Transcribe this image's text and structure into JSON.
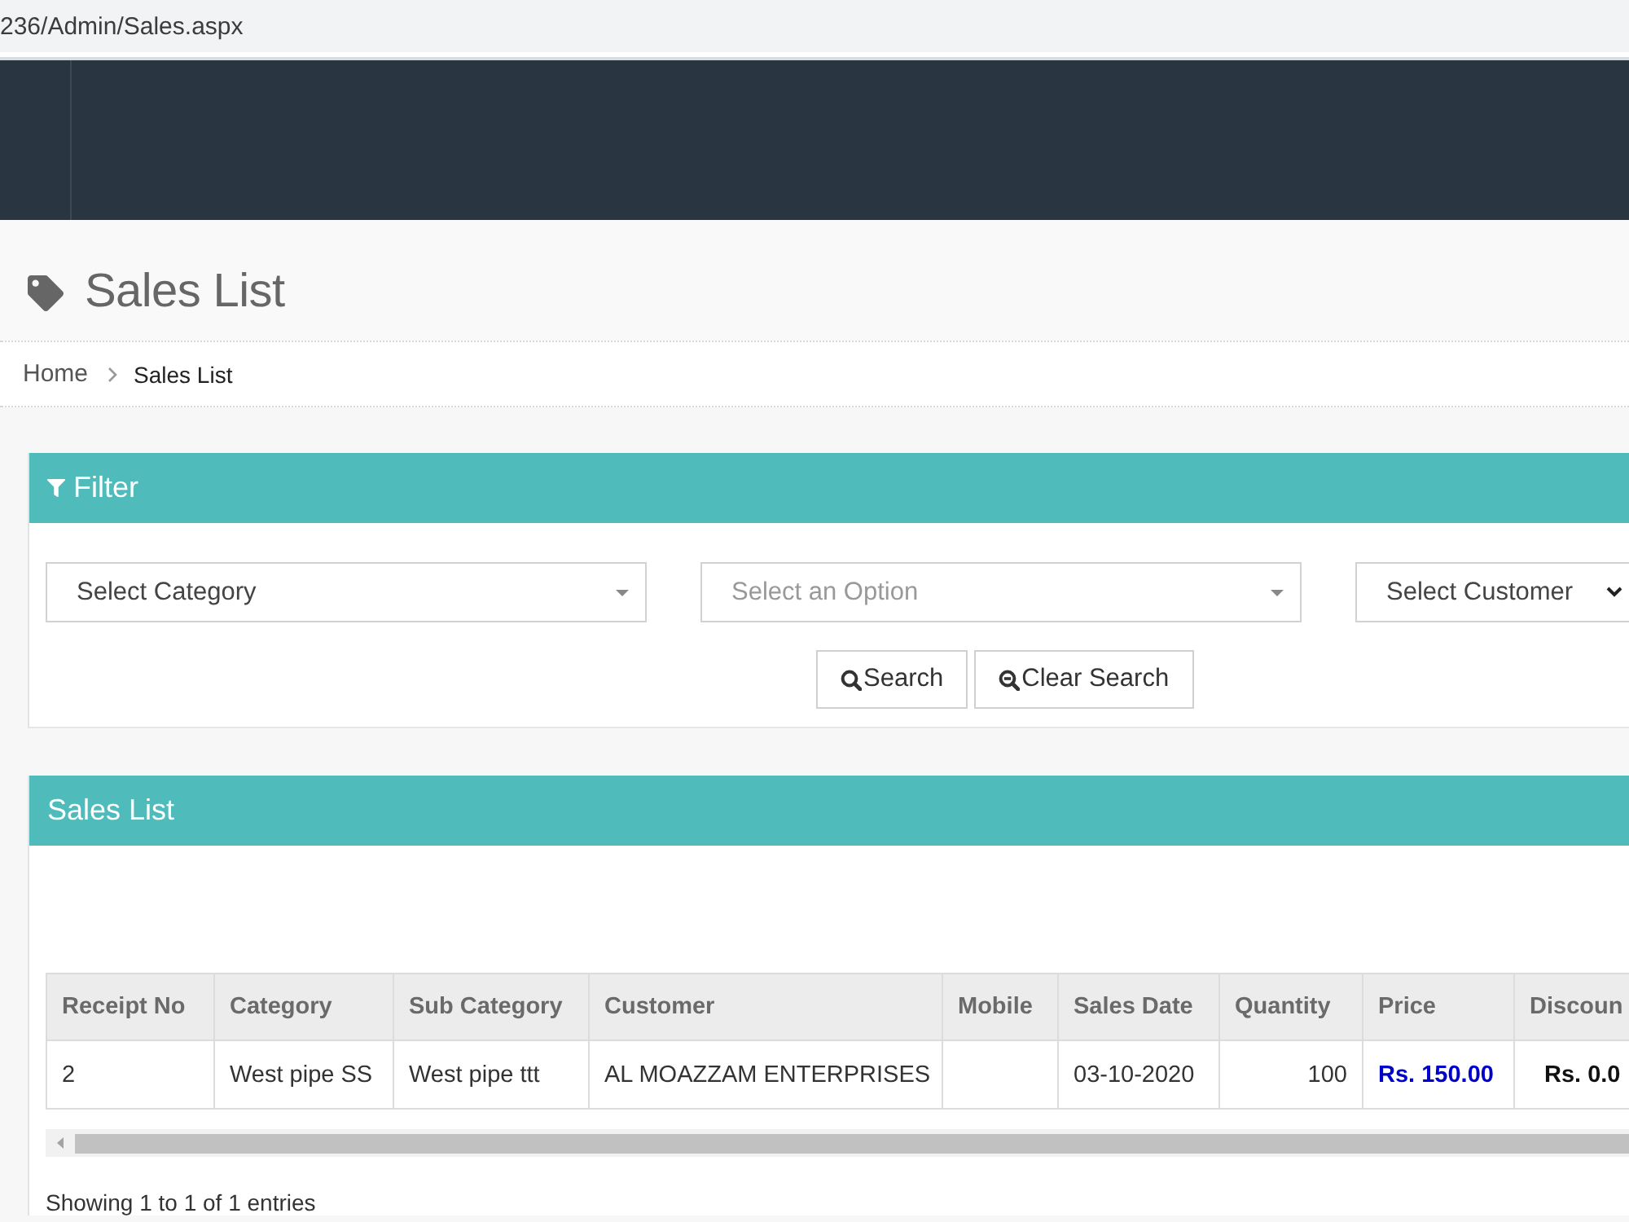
{
  "browser": {
    "url": "236/Admin/Sales.aspx"
  },
  "page_header": {
    "title": "Sales List"
  },
  "breadcrumb": [
    {
      "label": "Home"
    },
    {
      "label": "Sales List"
    }
  ],
  "filter_panel": {
    "title": "Filter",
    "selects": [
      {
        "kind": "select2",
        "value": "Select Category"
      },
      {
        "kind": "select2",
        "placeholder": "Select an Option"
      },
      {
        "kind": "native",
        "value": "Select Customer"
      }
    ],
    "buttons": [
      {
        "kind": "search",
        "label": "Search"
      },
      {
        "kind": "clear",
        "label": "Clear Search"
      }
    ]
  },
  "sales_panel": {
    "title": "Sales List",
    "table": {
      "columns": [
        {
          "label": "Receipt No",
          "kind": "text"
        },
        {
          "label": "Category",
          "kind": "text"
        },
        {
          "label": "Sub Category",
          "kind": "text"
        },
        {
          "label": "Customer",
          "kind": "text"
        },
        {
          "label": "Mobile",
          "kind": "text"
        },
        {
          "label": "Sales Date",
          "kind": "text"
        },
        {
          "label": "Quantity",
          "kind": "number"
        },
        {
          "label": "Price",
          "kind": "price"
        },
        {
          "label": "Discoun",
          "kind": "discount"
        }
      ],
      "rows": [
        {
          "cells": [
            "2",
            "West pipe SS",
            "West pipe ttt",
            "AL MOAZZAM ENTERPRISES",
            null,
            "03-10-2020",
            "100",
            "Rs. 150.00",
            "Rs. 0.0"
          ]
        }
      ]
    },
    "info": "Showing 1 to 1 of 1 entries"
  }
}
